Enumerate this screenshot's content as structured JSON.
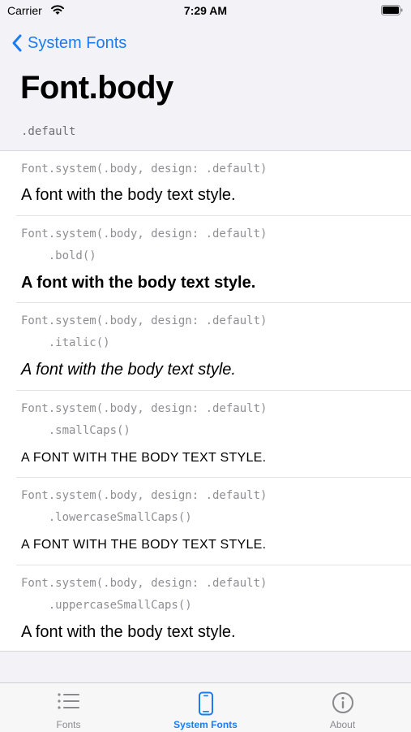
{
  "status_bar": {
    "carrier": "Carrier",
    "time": "7:29 AM"
  },
  "nav": {
    "back_label": "System Fonts",
    "title": "Font.body"
  },
  "section": {
    "header": ".default"
  },
  "rows": [
    {
      "code": "Font.system(.body, design: .default)",
      "modifier": "",
      "sample": "A font with the body text style."
    },
    {
      "code": "Font.system(.body, design: .default)",
      "modifier": "    .bold()",
      "sample": "A font with the body text style."
    },
    {
      "code": "Font.system(.body, design: .default)",
      "modifier": "    .italic()",
      "sample": "A font with the body text style."
    },
    {
      "code": "Font.system(.body, design: .default)",
      "modifier": "    .smallCaps()",
      "sample": "A FONT WITH THE BODY TEXT STYLE."
    },
    {
      "code": "Font.system(.body, design: .default)",
      "modifier": "    .lowercaseSmallCaps()",
      "sample": "A FONT WITH THE BODY TEXT STYLE."
    },
    {
      "code": "Font.system(.body, design: .default)",
      "modifier": "    .uppercaseSmallCaps()",
      "sample": "A font with the body text style."
    }
  ],
  "tabs": [
    {
      "label": "Fonts",
      "icon": "list-icon"
    },
    {
      "label": "System Fonts",
      "icon": "phone-icon",
      "active": true
    },
    {
      "label": "About",
      "icon": "info-icon"
    }
  ],
  "colors": {
    "accent": "#1a7cf5",
    "background": "#f2f2f7",
    "secondary_text": "#8e8e93"
  }
}
